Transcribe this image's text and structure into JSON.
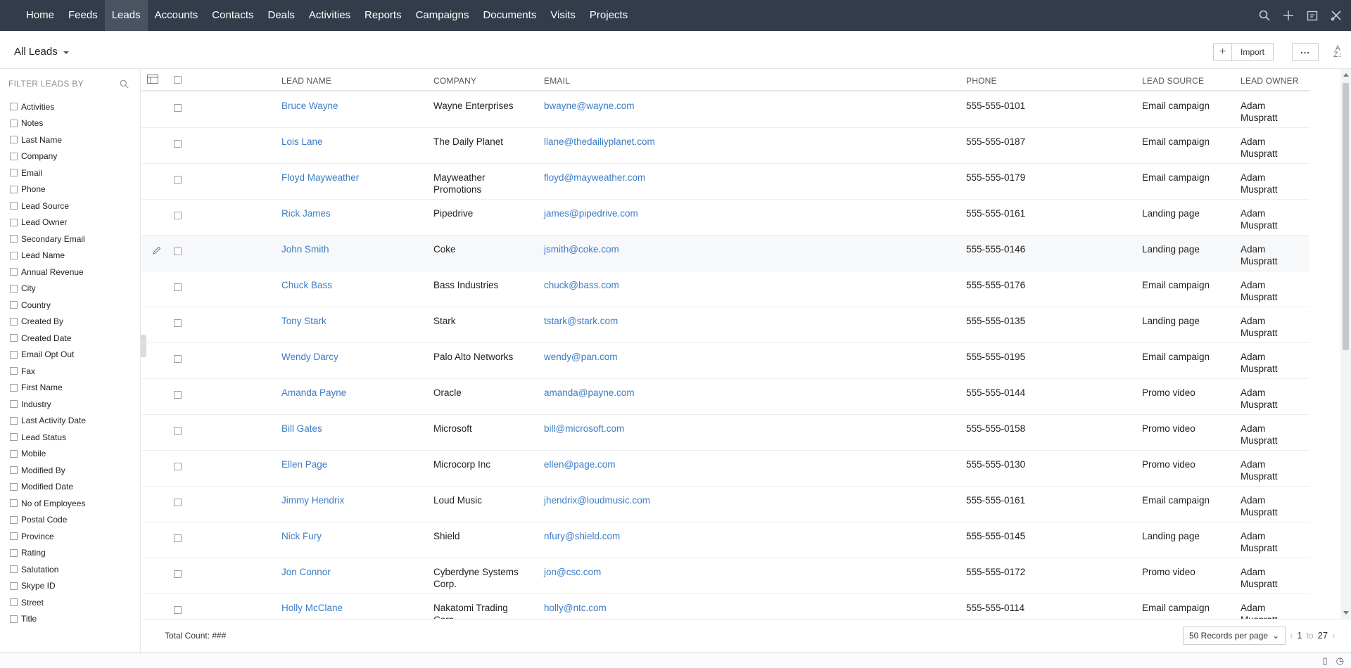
{
  "nav": {
    "tabs": [
      "Home",
      "Feeds",
      "Leads",
      "Accounts",
      "Contacts",
      "Deals",
      "Activities",
      "Reports",
      "Campaigns",
      "Documents",
      "Visits",
      "Projects"
    ],
    "active": "Leads",
    "icons": [
      "search-icon",
      "plus-icon",
      "calendar-icon",
      "tools-icon"
    ]
  },
  "header": {
    "view_label": "All Leads",
    "import_label": "Import",
    "more_label": "..."
  },
  "sidebar": {
    "title": "FILTER LEADS BY",
    "filters": [
      "Activities",
      "Notes",
      "Last Name",
      "Company",
      "Email",
      "Phone",
      "Lead Source",
      "Lead Owner",
      "Secondary Email",
      "Lead Name",
      "Annual Revenue",
      "City",
      "Country",
      "Created By",
      "Created Date",
      "Email Opt Out",
      "Fax",
      "First Name",
      "Industry",
      "Last Activity Date",
      "Lead Status",
      "Mobile",
      "Modified By",
      "Modified Date",
      "No of Employees",
      "Postal Code",
      "Province",
      "Rating",
      "Salutation",
      "Skype ID",
      "Street",
      "Title"
    ]
  },
  "table": {
    "columns": {
      "lead_name": "LEAD NAME",
      "company": "COMPANY",
      "email": "EMAIL",
      "phone": "PHONE",
      "lead_source": "LEAD SOURCE",
      "lead_owner": "LEAD OWNER"
    },
    "rows": [
      {
        "name": "Bruce Wayne",
        "company": "Wayne Enterprises",
        "email": "bwayne@wayne.com",
        "phone": "555-555-0101",
        "source": "Email campaign",
        "owner": "Adam Muspratt"
      },
      {
        "name": "Lois Lane",
        "company": "The Daily Planet",
        "email": "llane@thedailiyplanet.com",
        "phone": "555-555-0187",
        "source": "Email campaign",
        "owner": "Adam Muspratt"
      },
      {
        "name": "Floyd Mayweather",
        "company": "Mayweather Promotions",
        "email": "floyd@mayweather.com",
        "phone": "555-555-0179",
        "source": "Email campaign",
        "owner": "Adam Muspratt"
      },
      {
        "name": "Rick James",
        "company": "Pipedrive",
        "email": "james@pipedrive.com",
        "phone": "555-555-0161",
        "source": "Landing page",
        "owner": "Adam Muspratt"
      },
      {
        "name": "John Smith",
        "company": "Coke",
        "email": "jsmith@coke.com",
        "phone": "555-555-0146",
        "source": "Landing page",
        "owner": "Adam Muspratt"
      },
      {
        "name": "Chuck Bass",
        "company": "Bass Industries",
        "email": "chuck@bass.com",
        "phone": "555-555-0176",
        "source": "Email campaign",
        "owner": "Adam Muspratt"
      },
      {
        "name": "Tony Stark",
        "company": "Stark",
        "email": "tstark@stark.com",
        "phone": "555-555-0135",
        "source": "Landing page",
        "owner": "Adam Muspratt"
      },
      {
        "name": "Wendy Darcy",
        "company": "Palo Alto Networks",
        "email": "wendy@pan.com",
        "phone": "555-555-0195",
        "source": "Email campaign",
        "owner": "Adam Muspratt"
      },
      {
        "name": "Amanda Payne",
        "company": "Oracle",
        "email": "amanda@payne.com",
        "phone": "555-555-0144",
        "source": "Promo video",
        "owner": "Adam Muspratt"
      },
      {
        "name": "Bill Gates",
        "company": "Microsoft",
        "email": "bill@microsoft.com",
        "phone": "555-555-0158",
        "source": "Promo video",
        "owner": "Adam Muspratt"
      },
      {
        "name": "Ellen Page",
        "company": "Microcorp Inc",
        "email": "ellen@page.com",
        "phone": "555-555-0130",
        "source": "Promo video",
        "owner": "Adam Muspratt"
      },
      {
        "name": "Jimmy Hendrix",
        "company": "Loud Music",
        "email": "jhendrix@loudmusic.com",
        "phone": "555-555-0161",
        "source": "Email campaign",
        "owner": "Adam Muspratt"
      },
      {
        "name": "Nick Fury",
        "company": "Shield",
        "email": "nfury@shield.com",
        "phone": "555-555-0145",
        "source": "Landing page",
        "owner": "Adam Muspratt"
      },
      {
        "name": "Jon Connor",
        "company": "Cyberdyne Systems Corp.",
        "email": "jon@csc.com",
        "phone": "555-555-0172",
        "source": "Promo video",
        "owner": "Adam Muspratt"
      },
      {
        "name": "Holly McClane",
        "company": "Nakatomi Trading Corp.",
        "email": "holly@ntc.com",
        "phone": "555-555-0114",
        "source": "Email campaign",
        "owner": "Adam Muspratt"
      }
    ],
    "hover_row": 4
  },
  "footer": {
    "total_count": "Total Count: ###",
    "per_page": "50 Records per page",
    "page_from": "1",
    "page_to_label": "to",
    "page_to": "27"
  },
  "colors": {
    "nav_bg": "#333c4a",
    "link": "#3c7cc4"
  }
}
